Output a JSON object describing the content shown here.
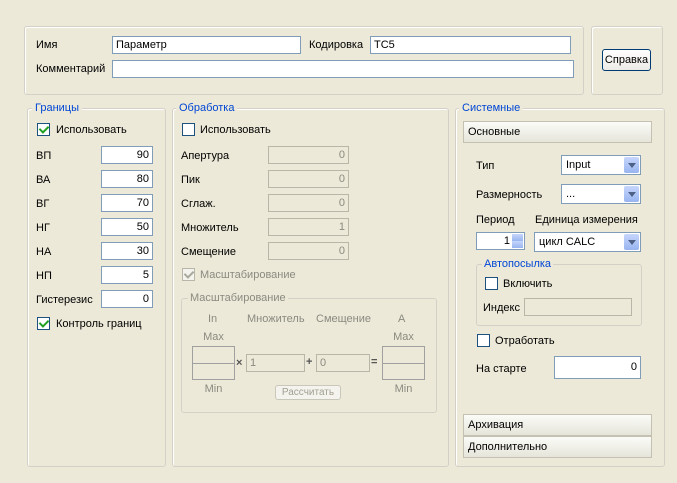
{
  "header": {
    "name_label": "Имя",
    "name_value": "Параметр",
    "code_label": "Кодировка",
    "code_value": "TC5",
    "comment_label": "Комментарий",
    "comment_value": "",
    "help_button": "Справка"
  },
  "limits": {
    "title": "Границы",
    "use_label": "Использовать",
    "use_checked": true,
    "rows": [
      {
        "label": "ВП",
        "value": "90"
      },
      {
        "label": "ВА",
        "value": "80"
      },
      {
        "label": "ВГ",
        "value": "70"
      },
      {
        "label": "НГ",
        "value": "50"
      },
      {
        "label": "НА",
        "value": "30"
      },
      {
        "label": "НП",
        "value": "5"
      }
    ],
    "hysteresis_label": "Гистерезис",
    "hysteresis_value": "0",
    "control_label": "Контроль границ",
    "control_checked": true
  },
  "processing": {
    "title": "Обработка",
    "use_label": "Использовать",
    "use_checked": false,
    "rows": [
      {
        "label": "Апертура",
        "value": "0"
      },
      {
        "label": "Пик",
        "value": "0"
      },
      {
        "label": "Сглаж.",
        "value": "0"
      },
      {
        "label": "Множитель",
        "value": "1"
      },
      {
        "label": "Смещение",
        "value": "0"
      }
    ],
    "scaling_check_label": "Масштабирование",
    "scaling_check_checked": true,
    "scaling": {
      "title": "Масштабирование",
      "in_label": "In",
      "multiplier_label": "Множитель",
      "offset_label": "Смещение",
      "a_label": "A",
      "max_label": "Max",
      "min_label": "Min",
      "multiplier_value": "1",
      "offset_value": "0",
      "times_sign": "×",
      "plus_sign": "+",
      "equals_sign": "=",
      "calc_button": "Рассчитать"
    }
  },
  "system": {
    "title": "Системные",
    "basic_tab": "Основные",
    "type_label": "Тип",
    "type_value": "Input",
    "dimension_label": "Размерность",
    "dimension_value": "...",
    "period_label": "Период",
    "period_value": "1",
    "unit_label": "Единица измерения",
    "unit_value": "цикл CALC",
    "autosend": {
      "title": "Автопосылка",
      "enable_label": "Включить",
      "enable_checked": false,
      "index_label": "Индекс",
      "index_value": ""
    },
    "process_label": "Отработать",
    "process_checked": false,
    "start_label": "На старте",
    "start_value": "0",
    "archive_tab": "Архивация",
    "extra_tab": "Дополнительно"
  }
}
